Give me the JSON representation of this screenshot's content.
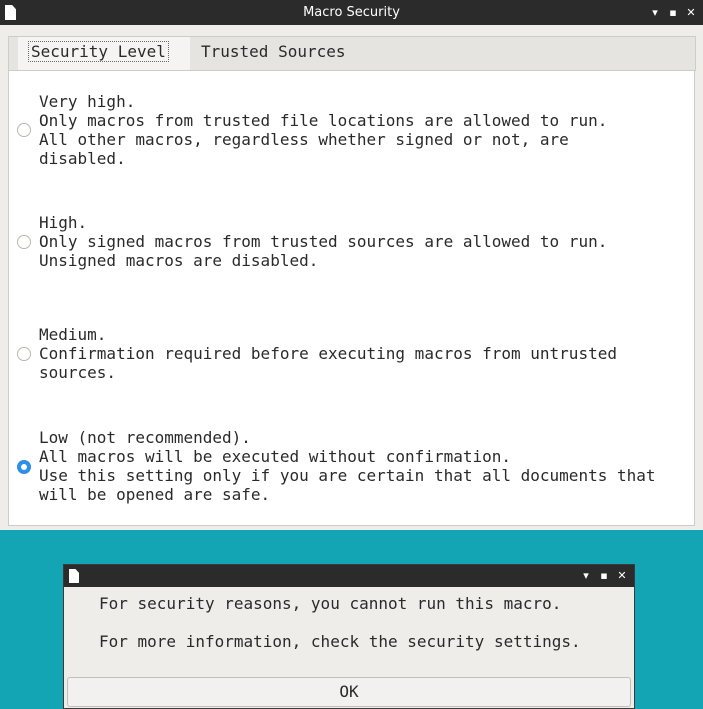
{
  "window": {
    "title": "Macro Security",
    "minimize_glyph": "▾",
    "maximize_glyph": "▪",
    "close_glyph": "✕"
  },
  "tabs": [
    {
      "label": "Security Level",
      "active": true
    },
    {
      "label": "Trusted Sources",
      "active": false
    }
  ],
  "options": [
    {
      "checked": false,
      "lines": [
        "Very high.",
        "Only macros from trusted file locations are allowed to run.",
        "All other macros, regardless whether signed or not, are",
        "disabled."
      ]
    },
    {
      "checked": false,
      "lines": [
        "High.",
        "Only signed macros from trusted sources are allowed to run.",
        "Unsigned macros are disabled."
      ]
    },
    {
      "checked": false,
      "lines": [
        "Medium.",
        "Confirmation required before executing macros from untrusted",
        "sources."
      ]
    },
    {
      "checked": true,
      "lines": [
        "Low (not recommended).",
        "All macros will be executed without confirmation.",
        "Use this setting only if you are certain that all documents that",
        "will be opened are safe."
      ]
    }
  ],
  "dialog": {
    "message1": "For security reasons, you cannot run this macro.",
    "message2": "For more information, check the security settings.",
    "ok_label": "OK"
  },
  "colors": {
    "desktop": "#14a5b5",
    "titlebar": "#2b2b2b",
    "accent": "#3a8fd9"
  }
}
